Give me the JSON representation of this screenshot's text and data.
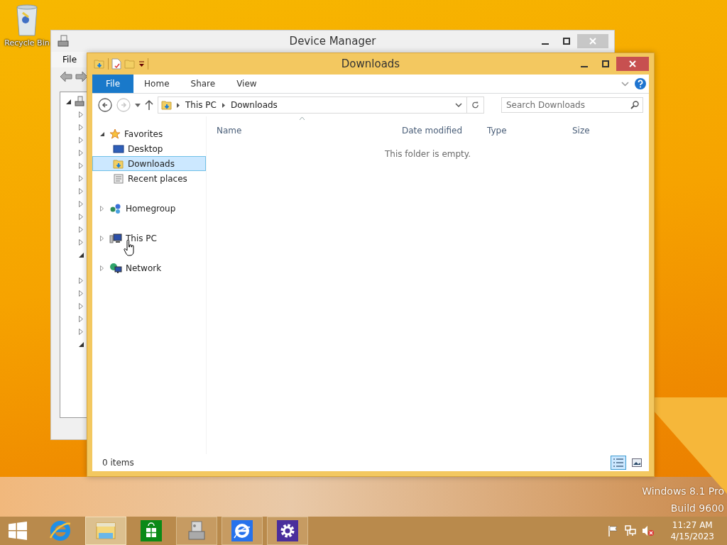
{
  "desktop": {
    "icons": [
      {
        "label": "Recycle Bin"
      }
    ],
    "watermark": [
      "Windows 8.1 Pro",
      "Build 9600"
    ]
  },
  "device_manager": {
    "title": "Device Manager",
    "menu": [
      "File"
    ],
    "tree": [
      {
        "kind": "expander",
        "expanded": true
      },
      {
        "kind": "expander",
        "expanded": false
      },
      {
        "kind": "expander",
        "expanded": false
      },
      {
        "kind": "expander",
        "expanded": false
      },
      {
        "kind": "expander",
        "expanded": false
      },
      {
        "kind": "expander",
        "expanded": false
      },
      {
        "kind": "expander",
        "expanded": false
      },
      {
        "kind": "expander",
        "expanded": false
      },
      {
        "kind": "expander",
        "expanded": false
      },
      {
        "kind": "expander",
        "expanded": false
      },
      {
        "kind": "expander",
        "expanded": false
      },
      {
        "kind": "expander",
        "expanded": false
      },
      {
        "kind": "expander",
        "expanded": true
      },
      {
        "kind": "leaf"
      },
      {
        "kind": "expander",
        "expanded": false
      },
      {
        "kind": "expander",
        "expanded": false
      },
      {
        "kind": "expander",
        "expanded": false
      },
      {
        "kind": "expander",
        "expanded": false
      },
      {
        "kind": "expander",
        "expanded": false
      },
      {
        "kind": "expander",
        "expanded": true
      }
    ]
  },
  "explorer": {
    "title": "Downloads",
    "ribbon_tabs": [
      {
        "label": "File",
        "selected": true
      },
      {
        "label": "Home",
        "selected": false
      },
      {
        "label": "Share",
        "selected": false
      },
      {
        "label": "View",
        "selected": false
      }
    ],
    "navigation": [
      {
        "kind": "back",
        "disabled": false
      },
      {
        "kind": "forward",
        "disabled": true
      }
    ],
    "breadcrumb": [
      "This PC",
      "Downloads"
    ],
    "search": {
      "placeholder": "Search Downloads"
    },
    "nav_pane": [
      {
        "label": "Favorites",
        "kind": "favorites",
        "expanded": true,
        "selected": false,
        "children": [
          {
            "label": "Desktop",
            "kind": "desktop",
            "selected": false
          },
          {
            "label": "Downloads",
            "kind": "downloads",
            "selected": true
          },
          {
            "label": "Recent places",
            "kind": "recent",
            "selected": false
          }
        ]
      },
      {
        "label": "Homegroup",
        "kind": "homegroup",
        "expanded": false,
        "selected": false
      },
      {
        "label": "This PC",
        "kind": "pc",
        "expanded": false,
        "selected": false
      },
      {
        "label": "Network",
        "kind": "network",
        "expanded": false,
        "selected": false
      }
    ],
    "columns": [
      "Name",
      "Date modified",
      "Type",
      "Size"
    ],
    "empty_message": "This folder is empty.",
    "status": "0 items",
    "view_buttons": [
      {
        "kind": "details",
        "selected": true
      },
      {
        "kind": "large-icons",
        "selected": false
      }
    ]
  },
  "taskbar": {
    "apps": [
      {
        "kind": "ie",
        "selected": false,
        "running": false
      },
      {
        "kind": "explorer",
        "selected": true,
        "running": true
      },
      {
        "kind": "store",
        "selected": false,
        "running": false
      },
      {
        "kind": "device-manager",
        "selected": false,
        "running": true
      },
      {
        "kind": "ie-modern",
        "selected": false,
        "running": true
      },
      {
        "kind": "settings",
        "selected": false,
        "running": true
      }
    ],
    "tray": {
      "time": "11:27 AM",
      "date": "4/15/2023"
    }
  }
}
